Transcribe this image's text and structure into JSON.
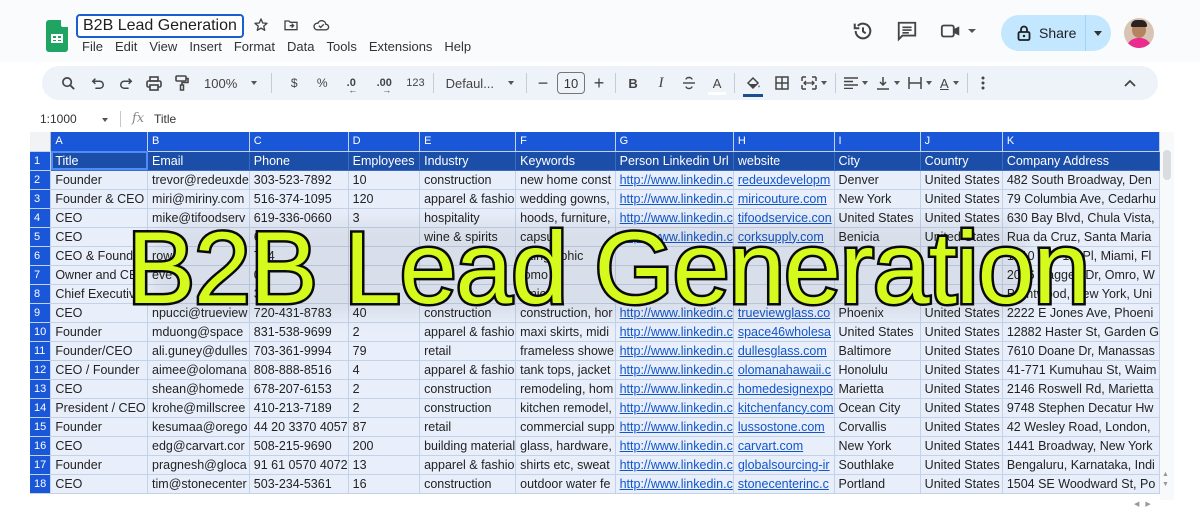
{
  "app": {
    "doc_title": "B2B Lead Generation",
    "menu": [
      "File",
      "Edit",
      "View",
      "Insert",
      "Format",
      "Data",
      "Tools",
      "Extensions",
      "Help"
    ],
    "share_label": "Share",
    "colors": {
      "accent": "#1a56d8",
      "header_row": "#1b4ea9",
      "cell_bg": "#e8effb",
      "share_bg": "#c2e7ff",
      "overlay_text": "#d4fb1c",
      "link": "#1155cc"
    }
  },
  "toolbar": {
    "zoom": "100%",
    "currency": "$",
    "percent": "%",
    "decrease_decimal": ".0",
    "increase_decimal": ".00",
    "number_format": "123",
    "font": "Defaul...",
    "font_size": "10",
    "bold": "B",
    "italic": "I",
    "strikethrough": "S",
    "text_color": "A",
    "text_rotation": "A"
  },
  "formula_bar": {
    "name_box": "1:1000",
    "fx": "fx",
    "value": "Title"
  },
  "sheet": {
    "column_letters": [
      "A",
      "B",
      "C",
      "D",
      "E",
      "F",
      "G",
      "H",
      "I",
      "J",
      "K"
    ],
    "row_numbers": [
      "1",
      "2",
      "3",
      "4",
      "5",
      "6",
      "7",
      "8",
      "9",
      "10",
      "11",
      "12",
      "13",
      "14",
      "15",
      "16",
      "17",
      "18"
    ],
    "headers": [
      "Title",
      "Email",
      "Phone",
      "Employees",
      "Industry",
      "Keywords",
      "Person Linkedin Url",
      "website",
      "City",
      "Country",
      "Company Address"
    ],
    "rows": [
      [
        "Founder",
        "trevor@redeuxde",
        "303-523-7892",
        "10",
        "construction",
        "new home const",
        "http://www.linkedin.c",
        "redeuxdevelopm",
        "Denver",
        "United States",
        "482 South Broadway, Den"
      ],
      [
        "Founder & CEO",
        "miri@miriny.com",
        "516-374-1095",
        "120",
        "apparel & fashio",
        "wedding gowns,",
        "http://www.linkedin.c",
        "miricouture.com",
        "New York",
        "United States",
        "79 Columbia Ave, Cedarhu"
      ],
      [
        "CEO",
        "mike@tifoodserv",
        "619-336-0660",
        "3",
        "hospitality",
        "hoods, furniture,",
        "http://www.linkedin.c",
        "tifoodservice.con",
        "United States",
        "United States",
        "630 Bay Blvd, Chula Vista,"
      ],
      [
        "CEO",
        "",
        "6 035",
        "",
        "wine & spirits",
        "capsu",
        "http://www.linkedin.c",
        "corksupply.com",
        "Benicia",
        "United States",
        "Rua da Cruz, Santa Maria"
      ],
      [
        "CEO & Founde",
        "rowell",
        "774",
        "",
        "",
        "inting aphic",
        "",
        "",
        "",
        "",
        "1910 NW 1st Pl, Miami, Fl"
      ],
      [
        "Owner and CEO",
        "eve",
        "00",
        "",
        "",
        "tomo",
        "",
        "",
        "",
        "",
        "2016 Daggett Dr, Omro, W"
      ],
      [
        "Chief Executive",
        "",
        "36",
        "",
        "",
        "timicro",
        "",
        "",
        "",
        "",
        "Brentwood, New York, Uni"
      ],
      [
        "CEO",
        "npucci@trueview",
        "720-431-8783",
        "40",
        "construction",
        "construction, hor",
        "http://www.linkedin.c",
        "trueviewglass.co",
        "Phoenix",
        "United States",
        "2222 E Jones Ave, Phoeni"
      ],
      [
        "Founder",
        "mduong@space",
        "831-538-9699",
        "2",
        "apparel & fashio",
        "maxi skirts, midi",
        "http://www.linkedin.c",
        "space46wholesa",
        "United States",
        "United States",
        "12882 Haster St, Garden G"
      ],
      [
        "Founder/CEO",
        "ali.guney@dulles",
        "703-361-9994",
        "79",
        "retail",
        "frameless showe",
        "http://www.linkedin.c",
        "dullesglass.com",
        "Baltimore",
        "United States",
        "7610 Doane Dr, Manassas"
      ],
      [
        "CEO / Founder",
        "aimee@olomana",
        "808-888-8516",
        "4",
        "apparel & fashio",
        "tank tops, jacket",
        "http://www.linkedin.c",
        "olomanahawaii.c",
        "Honolulu",
        "United States",
        "41-771 Kumuhau St, Waim"
      ],
      [
        "CEO",
        "shean@homede",
        "678-207-6153",
        "2",
        "construction",
        "remodeling, hom",
        "http://www.linkedin.c",
        "homedesignexpo",
        "Marietta",
        "United States",
        "2146 Roswell Rd, Marietta"
      ],
      [
        "President / CEO",
        "krohe@millscree",
        "410-213-7189",
        "2",
        "construction",
        "kitchen remodel,",
        "http://www.linkedin.c",
        "kitchenfancy.com",
        "Ocean City",
        "United States",
        "9748 Stephen Decatur Hw"
      ],
      [
        "Founder",
        "kesumaa@orego",
        "44 20 3370 4057",
        "87",
        "retail",
        "commercial supp",
        "http://www.linkedin.c",
        "lussostone.com",
        "Corvallis",
        "United States",
        "42 Wesley Road, London,"
      ],
      [
        "CEO",
        "edg@carvart.cor",
        "508-215-9690",
        "200",
        "building material",
        "glass, hardware,",
        "http://www.linkedin.c",
        "carvart.com",
        "New York",
        "United States",
        "1441 Broadway, New York"
      ],
      [
        "Founder",
        "pragnesh@gloca",
        "91 61 0570 4072",
        "13",
        "apparel & fashio",
        "shirts etc, sweat",
        "http://www.linkedin.c",
        "globalsourcing-ir",
        "Southlake",
        "United States",
        "Bengaluru, Karnataka, Indi"
      ],
      [
        "CEO",
        "tim@stonecenter",
        "503-234-5361",
        "16",
        "construction",
        "outdoor water fe",
        "http://www.linkedin.c",
        "stonecenterinc.c",
        "Portland",
        "United States",
        "1504 SE Woodward St, Po"
      ]
    ]
  },
  "overlay": {
    "headline": "B2B Lead Generation"
  }
}
